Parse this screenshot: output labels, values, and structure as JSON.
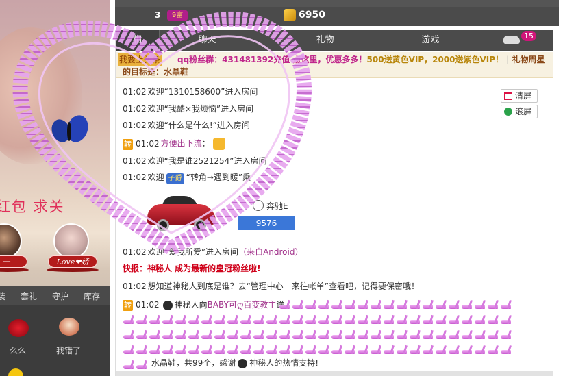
{
  "rank": {
    "number": "3",
    "badge": "9富",
    "score": "6950"
  },
  "tabs": [
    "相",
    "聊天",
    "礼物",
    "游戏",
    ""
  ],
  "car_badge": "15",
  "announce": {
    "tag": "我要上头条",
    "line1_a": "qq粉丝群：431481392充值 点这里，优惠多多！",
    "line1_b": "500送黄色VIP，2000送紫色VIP！",
    "sep": "|",
    "line1_c": "礼物周星",
    "line2": "的目标是：水晶鞋"
  },
  "buttons": {
    "clear": "清屏",
    "scroll": "滚屏"
  },
  "messages": [
    {
      "time": "01:02",
      "pre": "欢迎",
      "name": "“1310158600”",
      "post": "进入房间"
    },
    {
      "time": "01:02",
      "pre": "欢迎",
      "name": "“我酷×我烦恼”",
      "post": "进入房间"
    },
    {
      "time": "01:02",
      "pre": "欢迎",
      "name": "“什么是什么!”",
      "post": "进入房间"
    },
    {
      "tag": "转",
      "time": "01:02",
      "name": "方便出下流",
      "post": "："
    },
    {
      "time": "01:02",
      "pre": "欢迎",
      "name": "“我是谁2521254”",
      "post": "进入房间"
    },
    {
      "time": "01:02",
      "pre": "欢迎",
      "badge": "子爵",
      "name": "“转角→遇到暖”",
      "post": "乘"
    }
  ],
  "car": {
    "name": "奔驰E",
    "value": "9576"
  },
  "msg_android": {
    "time": "01:02",
    "pre": "欢迎",
    "name": "“爱我所爱”",
    "post": "进入房间",
    "from": "（来自Android）"
  },
  "msg_flash": "快报：神秘人 成为最新的皇冠粉丝啦!",
  "msg_tip": {
    "time": "01:02",
    "text": "想知道神秘人到底是谁？去“管理中心－来往帐单”查看吧，记得要保密哦！"
  },
  "msg_gift": {
    "tag": "转",
    "time": "01:02",
    "who": "神秘人向",
    "to": "BABY可ღ百变教主",
    "post": "送"
  },
  "summary": {
    "gift": "水晶鞋，共99个，感谢",
    "who": "神秘人的热情支持!"
  },
  "left": {
    "promo": "红包 求关",
    "name1": "一",
    "name2": "Love❤娇",
    "tabs": [
      "装",
      "套礼",
      "守护",
      "库存"
    ],
    "gift1": "么么",
    "gift2": "我错了"
  },
  "colors": {
    "accent_pink": "#c0278c",
    "tab_bg": "#4b4b4b",
    "car_value_bg": "#3b77d8",
    "badge": "#d0157a"
  }
}
